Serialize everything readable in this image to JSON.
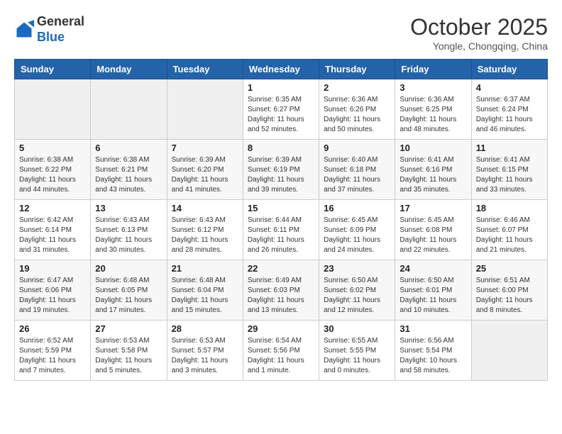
{
  "header": {
    "logo_general": "General",
    "logo_blue": "Blue",
    "month_title": "October 2025",
    "location": "Yongle, Chongqing, China"
  },
  "days_of_week": [
    "Sunday",
    "Monday",
    "Tuesday",
    "Wednesday",
    "Thursday",
    "Friday",
    "Saturday"
  ],
  "weeks": [
    [
      {
        "day": "",
        "info": ""
      },
      {
        "day": "",
        "info": ""
      },
      {
        "day": "",
        "info": ""
      },
      {
        "day": "1",
        "info": "Sunrise: 6:35 AM\nSunset: 6:27 PM\nDaylight: 11 hours\nand 52 minutes."
      },
      {
        "day": "2",
        "info": "Sunrise: 6:36 AM\nSunset: 6:26 PM\nDaylight: 11 hours\nand 50 minutes."
      },
      {
        "day": "3",
        "info": "Sunrise: 6:36 AM\nSunset: 6:25 PM\nDaylight: 11 hours\nand 48 minutes."
      },
      {
        "day": "4",
        "info": "Sunrise: 6:37 AM\nSunset: 6:24 PM\nDaylight: 11 hours\nand 46 minutes."
      }
    ],
    [
      {
        "day": "5",
        "info": "Sunrise: 6:38 AM\nSunset: 6:22 PM\nDaylight: 11 hours\nand 44 minutes."
      },
      {
        "day": "6",
        "info": "Sunrise: 6:38 AM\nSunset: 6:21 PM\nDaylight: 11 hours\nand 43 minutes."
      },
      {
        "day": "7",
        "info": "Sunrise: 6:39 AM\nSunset: 6:20 PM\nDaylight: 11 hours\nand 41 minutes."
      },
      {
        "day": "8",
        "info": "Sunrise: 6:39 AM\nSunset: 6:19 PM\nDaylight: 11 hours\nand 39 minutes."
      },
      {
        "day": "9",
        "info": "Sunrise: 6:40 AM\nSunset: 6:18 PM\nDaylight: 11 hours\nand 37 minutes."
      },
      {
        "day": "10",
        "info": "Sunrise: 6:41 AM\nSunset: 6:16 PM\nDaylight: 11 hours\nand 35 minutes."
      },
      {
        "day": "11",
        "info": "Sunrise: 6:41 AM\nSunset: 6:15 PM\nDaylight: 11 hours\nand 33 minutes."
      }
    ],
    [
      {
        "day": "12",
        "info": "Sunrise: 6:42 AM\nSunset: 6:14 PM\nDaylight: 11 hours\nand 31 minutes."
      },
      {
        "day": "13",
        "info": "Sunrise: 6:43 AM\nSunset: 6:13 PM\nDaylight: 11 hours\nand 30 minutes."
      },
      {
        "day": "14",
        "info": "Sunrise: 6:43 AM\nSunset: 6:12 PM\nDaylight: 11 hours\nand 28 minutes."
      },
      {
        "day": "15",
        "info": "Sunrise: 6:44 AM\nSunset: 6:11 PM\nDaylight: 11 hours\nand 26 minutes."
      },
      {
        "day": "16",
        "info": "Sunrise: 6:45 AM\nSunset: 6:09 PM\nDaylight: 11 hours\nand 24 minutes."
      },
      {
        "day": "17",
        "info": "Sunrise: 6:45 AM\nSunset: 6:08 PM\nDaylight: 11 hours\nand 22 minutes."
      },
      {
        "day": "18",
        "info": "Sunrise: 6:46 AM\nSunset: 6:07 PM\nDaylight: 11 hours\nand 21 minutes."
      }
    ],
    [
      {
        "day": "19",
        "info": "Sunrise: 6:47 AM\nSunset: 6:06 PM\nDaylight: 11 hours\nand 19 minutes."
      },
      {
        "day": "20",
        "info": "Sunrise: 6:48 AM\nSunset: 6:05 PM\nDaylight: 11 hours\nand 17 minutes."
      },
      {
        "day": "21",
        "info": "Sunrise: 6:48 AM\nSunset: 6:04 PM\nDaylight: 11 hours\nand 15 minutes."
      },
      {
        "day": "22",
        "info": "Sunrise: 6:49 AM\nSunset: 6:03 PM\nDaylight: 11 hours\nand 13 minutes."
      },
      {
        "day": "23",
        "info": "Sunrise: 6:50 AM\nSunset: 6:02 PM\nDaylight: 11 hours\nand 12 minutes."
      },
      {
        "day": "24",
        "info": "Sunrise: 6:50 AM\nSunset: 6:01 PM\nDaylight: 11 hours\nand 10 minutes."
      },
      {
        "day": "25",
        "info": "Sunrise: 6:51 AM\nSunset: 6:00 PM\nDaylight: 11 hours\nand 8 minutes."
      }
    ],
    [
      {
        "day": "26",
        "info": "Sunrise: 6:52 AM\nSunset: 5:59 PM\nDaylight: 11 hours\nand 7 minutes."
      },
      {
        "day": "27",
        "info": "Sunrise: 6:53 AM\nSunset: 5:58 PM\nDaylight: 11 hours\nand 5 minutes."
      },
      {
        "day": "28",
        "info": "Sunrise: 6:53 AM\nSunset: 5:57 PM\nDaylight: 11 hours\nand 3 minutes."
      },
      {
        "day": "29",
        "info": "Sunrise: 6:54 AM\nSunset: 5:56 PM\nDaylight: 11 hours\nand 1 minute."
      },
      {
        "day": "30",
        "info": "Sunrise: 6:55 AM\nSunset: 5:55 PM\nDaylight: 11 hours\nand 0 minutes."
      },
      {
        "day": "31",
        "info": "Sunrise: 6:56 AM\nSunset: 5:54 PM\nDaylight: 10 hours\nand 58 minutes."
      },
      {
        "day": "",
        "info": ""
      }
    ]
  ]
}
